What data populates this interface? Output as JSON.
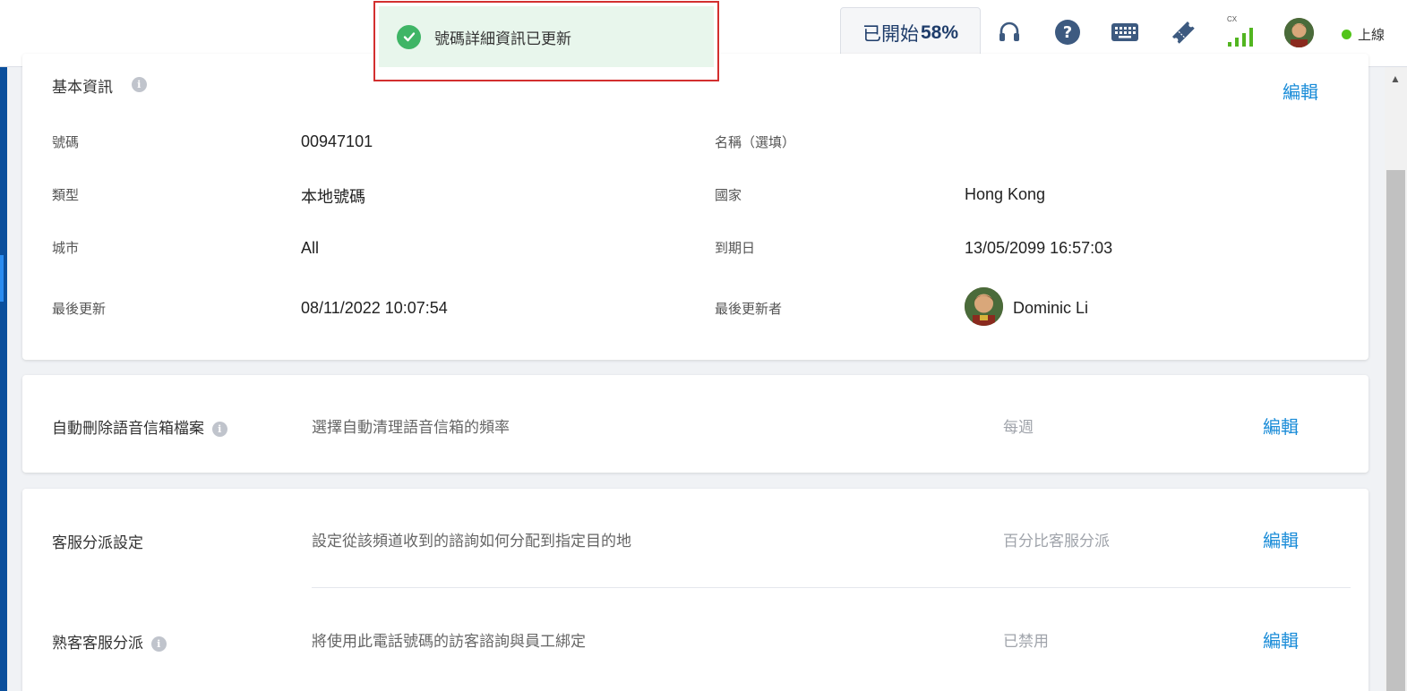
{
  "toast": {
    "message": "號碼詳細資訊已更新"
  },
  "topbar": {
    "progress_prefix": "已開始",
    "progress_value": "58%",
    "signal_label": "CX",
    "status_label": "上線"
  },
  "basic_info": {
    "title": "基本資訊",
    "edit_label": "編輯",
    "fields": {
      "number_label": "號碼",
      "number_value": "00947101",
      "name_label": "名稱（選填）",
      "name_value": "",
      "type_label": "類型",
      "type_value": "本地號碼",
      "country_label": "國家",
      "country_value": "Hong Kong",
      "city_label": "城市",
      "city_value": "All",
      "expiry_label": "到期日",
      "expiry_value": "13/05/2099 16:57:03",
      "updated_label": "最後更新",
      "updated_value": "08/11/2022 10:07:54",
      "updated_by_label": "最後更新者",
      "updated_by_value": "Dominic Li"
    }
  },
  "auto_delete": {
    "title": "自動刪除語音信箱檔案",
    "description": "選擇自動清理語音信箱的頻率",
    "value": "每週",
    "edit_label": "編輯"
  },
  "routing": {
    "title": "客服分派設定",
    "description": "設定從該頻道收到的諮詢如何分配到指定目的地",
    "value": "百分比客服分派",
    "edit_label": "編輯"
  },
  "sticky": {
    "title": "熟客客服分派",
    "description": "將使用此電話號碼的訪客諮詢與員工綁定",
    "value": "已禁用",
    "edit_label": "編輯"
  },
  "colors": {
    "accent": "#1a8cd8",
    "nav": "#0b4f9c",
    "success": "#3fb566",
    "toast_border": "#d32f2f",
    "online": "#52c41a"
  }
}
